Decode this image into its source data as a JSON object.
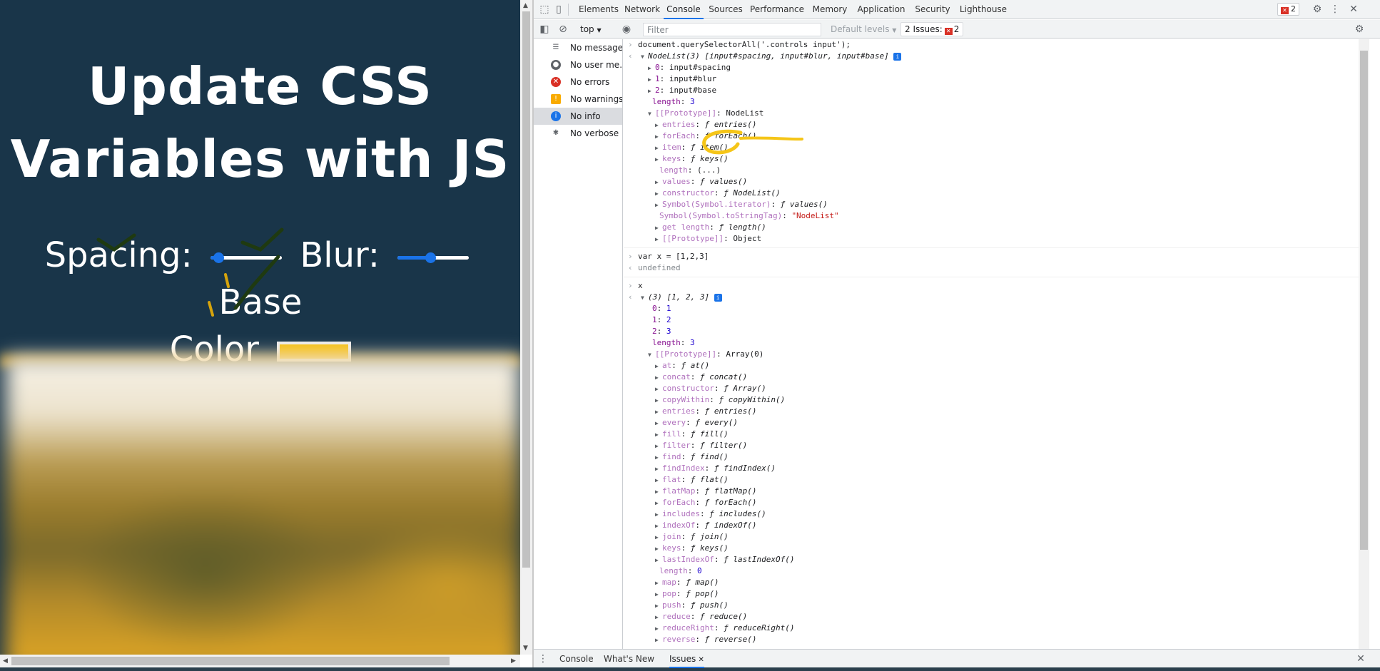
{
  "page": {
    "title_line1": "Update CSS",
    "title_line2": "Variables with JS",
    "controls": {
      "spacing_label": "Spacing:",
      "spacing_value": 0.05,
      "blur_label": "Blur:",
      "blur_value": 0.45,
      "base_label_1": "Base",
      "base_label_2": "Color",
      "base_color": "#f6bf10"
    },
    "background_color": "#193549"
  },
  "devtools": {
    "tabs": [
      "Elements",
      "Network",
      "Console",
      "Sources",
      "Performance",
      "Memory",
      "Application",
      "Security",
      "Lighthouse"
    ],
    "active_tab": "Console",
    "error_count": "2",
    "toolbar": {
      "context": "top",
      "filter_placeholder": "Filter",
      "levels": "Default levels",
      "issues_label": "2 Issues:",
      "issues_count": "2"
    },
    "sidebar": [
      {
        "label": "No messages",
        "icon": "list-icon"
      },
      {
        "label": "No user me...",
        "icon": "user-icon"
      },
      {
        "label": "No errors",
        "icon": "error-icon"
      },
      {
        "label": "No warnings",
        "icon": "warning-icon"
      },
      {
        "label": "No info",
        "icon": "info-icon"
      },
      {
        "label": "No verbose",
        "icon": "bug-icon"
      }
    ],
    "console": {
      "cmd1": "document.querySelectorAll('.controls input');",
      "nodelist_head": "NodeList(3) [input#spacing, input#blur, input#base]",
      "nl_items": [
        {
          "key": "0",
          "val": "input#spacing"
        },
        {
          "key": "1",
          "val": "input#blur"
        },
        {
          "key": "2",
          "val": "input#base"
        }
      ],
      "nl_length": "3",
      "nl_proto": "NodeList",
      "nl_proto_props": [
        {
          "key": "entries",
          "val": "entries()",
          "exp": true
        },
        {
          "key": "forEach",
          "val": "forEach()",
          "exp": true
        },
        {
          "key": "item",
          "val": "item()",
          "exp": true
        },
        {
          "key": "keys",
          "val": "keys()",
          "exp": true
        },
        {
          "key": "length",
          "val": "(...)",
          "exp": false,
          "plain": true
        },
        {
          "key": "values",
          "val": "values()",
          "exp": true
        },
        {
          "key": "constructor",
          "val": "NodeList()",
          "exp": true
        },
        {
          "key": "Symbol(Symbol.iterator)",
          "val": "values()",
          "exp": true
        },
        {
          "key": "Symbol(Symbol.toStringTag)",
          "val": "\"NodeList\"",
          "exp": false,
          "str": true
        },
        {
          "key": "get length",
          "val": "length()",
          "exp": true
        },
        {
          "key": "[[Prototype]]",
          "val": "Object",
          "exp": true,
          "plain": true
        }
      ],
      "cmd2": "var x = [1,2,3]",
      "res2": "undefined",
      "cmd3": "x",
      "arr_head": "(3) [1, 2, 3]",
      "arr_items": [
        {
          "key": "0",
          "val": "1"
        },
        {
          "key": "1",
          "val": "2"
        },
        {
          "key": "2",
          "val": "3"
        }
      ],
      "arr_length": "3",
      "arr_proto": "Array(0)",
      "arr_proto_props": [
        {
          "key": "at",
          "val": "at()"
        },
        {
          "key": "concat",
          "val": "concat()"
        },
        {
          "key": "constructor",
          "val": "Array()"
        },
        {
          "key": "copyWithin",
          "val": "copyWithin()"
        },
        {
          "key": "entries",
          "val": "entries()"
        },
        {
          "key": "every",
          "val": "every()"
        },
        {
          "key": "fill",
          "val": "fill()"
        },
        {
          "key": "filter",
          "val": "filter()"
        },
        {
          "key": "find",
          "val": "find()"
        },
        {
          "key": "findIndex",
          "val": "findIndex()"
        },
        {
          "key": "flat",
          "val": "flat()"
        },
        {
          "key": "flatMap",
          "val": "flatMap()"
        },
        {
          "key": "forEach",
          "val": "forEach()"
        },
        {
          "key": "includes",
          "val": "includes()"
        },
        {
          "key": "indexOf",
          "val": "indexOf()"
        },
        {
          "key": "join",
          "val": "join()"
        },
        {
          "key": "keys",
          "val": "keys()"
        },
        {
          "key": "lastIndexOf",
          "val": "lastIndexOf()"
        },
        {
          "key": "length",
          "val": "0",
          "plain": true
        },
        {
          "key": "map",
          "val": "map()"
        },
        {
          "key": "pop",
          "val": "pop()"
        },
        {
          "key": "push",
          "val": "push()"
        },
        {
          "key": "reduce",
          "val": "reduce()"
        },
        {
          "key": "reduceRight",
          "val": "reduceRight()"
        },
        {
          "key": "reverse",
          "val": "reverse()"
        }
      ]
    },
    "drawer_tabs": [
      "Console",
      "What's New",
      "Issues"
    ],
    "active_drawer_tab": "Issues",
    "highlight_color": "#f5c518"
  }
}
